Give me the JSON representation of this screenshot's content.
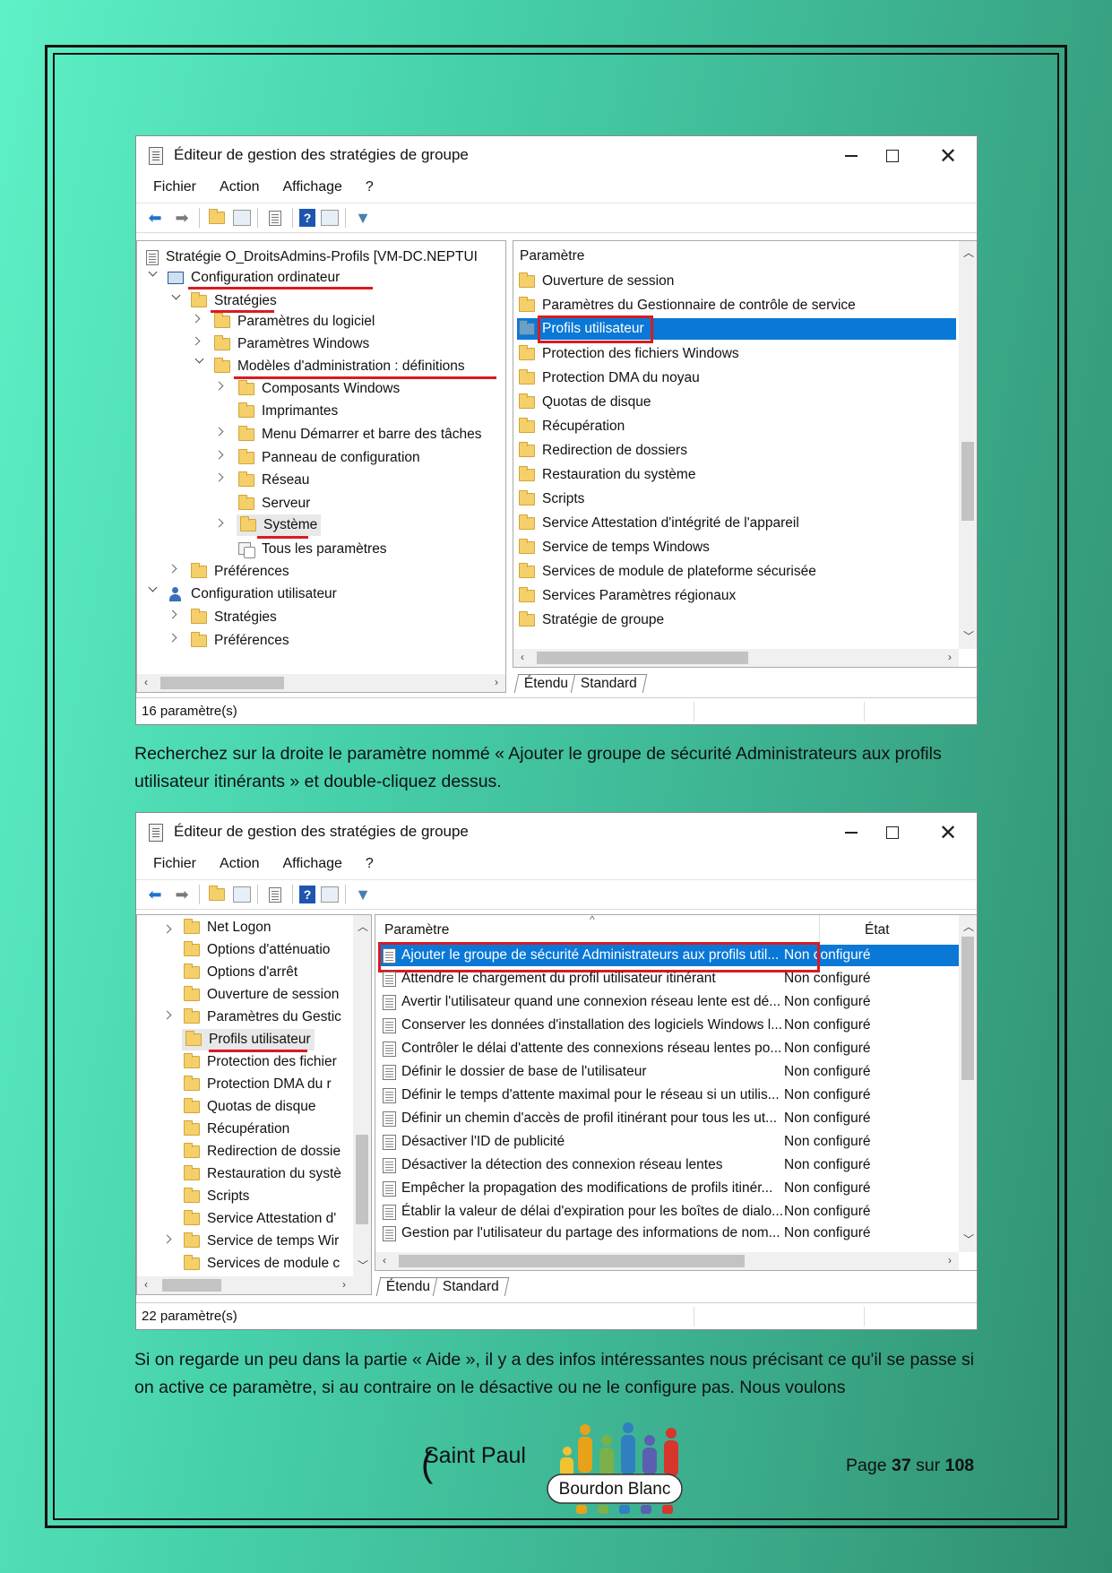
{
  "window1": {
    "title": "Éditeur de gestion des stratégies de groupe",
    "menu": [
      "Fichier",
      "Action",
      "Affichage",
      "?"
    ],
    "tree": {
      "root": "Stratégie O_DroitsAdmins-Profils [VM-DC.NEPTUI",
      "items": [
        "Configuration ordinateur",
        "Stratégies",
        "Paramètres du logiciel",
        "Paramètres Windows",
        "Modèles d'administration : définitions",
        "Composants Windows",
        "Imprimantes",
        "Menu Démarrer et barre des tâches",
        "Panneau de configuration",
        "Réseau",
        "Serveur",
        "Système",
        "Tous les paramètres",
        "Préférences",
        "Configuration utilisateur",
        "Stratégies",
        "Préférences"
      ]
    },
    "list_header": "Paramètre",
    "list": [
      "Ouverture de session",
      "Paramètres du Gestionnaire de contrôle de service",
      "Profils utilisateur",
      "Protection des fichiers Windows",
      "Protection DMA du noyau",
      "Quotas de disque",
      "Récupération",
      "Redirection de dossiers",
      "Restauration du système",
      "Scripts",
      "Service Attestation d'intégrité de l'appareil",
      "Service de temps Windows",
      "Services de module de plateforme sécurisée",
      "Services Paramètres régionaux",
      "Stratégie de groupe"
    ],
    "tabs": [
      "Étendu",
      "Standard"
    ],
    "status": "16 paramètre(s)"
  },
  "paragraph1": "Recherchez sur la droite le paramètre nommé « Ajouter le groupe de sécurité Administrateurs aux profils utilisateur itinérants » et double-cliquez dessus.",
  "window2": {
    "title": "Éditeur de gestion des stratégies de groupe",
    "menu": [
      "Fichier",
      "Action",
      "Affichage",
      "?"
    ],
    "tree": [
      "Net Logon",
      "Options d'atténuatio",
      "Options d'arrêt",
      "Ouverture de session",
      "Paramètres du Gestic",
      "Profils utilisateur",
      "Protection des fichier",
      "Protection DMA du r",
      "Quotas de disque",
      "Récupération",
      "Redirection de dossie",
      "Restauration du systè",
      "Scripts",
      "Service Attestation d'",
      "Service de temps Wir",
      "Services de module c"
    ],
    "col_param": "Paramètre",
    "col_state": "État",
    "rows": [
      {
        "name": "Ajouter le groupe de sécurité Administrateurs aux profils util...",
        "state": "Non configuré"
      },
      {
        "name": "Attendre le chargement du profil utilisateur itinérant",
        "state": "Non configuré"
      },
      {
        "name": "Avertir l'utilisateur quand une connexion réseau lente est dé...",
        "state": "Non configuré"
      },
      {
        "name": "Conserver les données d'installation des logiciels Windows l...",
        "state": "Non configuré"
      },
      {
        "name": "Contrôler le délai d'attente des connexions réseau lentes po...",
        "state": "Non configuré"
      },
      {
        "name": "Définir le dossier de base de l'utilisateur",
        "state": "Non configuré"
      },
      {
        "name": "Définir le temps d'attente maximal pour le réseau si un utilis...",
        "state": "Non configuré"
      },
      {
        "name": "Définir un chemin d'accès de profil itinérant pour tous les ut...",
        "state": "Non configuré"
      },
      {
        "name": "Désactiver l'ID de publicité",
        "state": "Non configuré"
      },
      {
        "name": "Désactiver la détection des connexion réseau lentes",
        "state": "Non configuré"
      },
      {
        "name": "Empêcher la propagation des modifications de profils itinér...",
        "state": "Non configuré"
      },
      {
        "name": "Établir la valeur de délai d'expiration pour les boîtes de dialo...",
        "state": "Non configuré"
      },
      {
        "name": "Gestion par l'utilisateur du partage des informations de nom...",
        "state": "Non configuré"
      }
    ],
    "tabs": [
      "Étendu",
      "Standard"
    ],
    "status": "22 paramètre(s)"
  },
  "paragraph2": "Si on regarde un peu dans la partie « Aide », il y a des infos intéressantes nous précisant ce qu'il se passe si on active ce paramètre, si au contraire on le désactive ou ne le configure pas. Nous voulons",
  "footer": {
    "brand_left": "Saint Paul",
    "brand_right": "Bourdon Blanc",
    "page_prefix": "Page",
    "page_current": "37",
    "page_mid": "sur",
    "page_total": "108"
  },
  "colors": {
    "selection": "#0a78d7",
    "highlight_red": "#d81b22"
  }
}
